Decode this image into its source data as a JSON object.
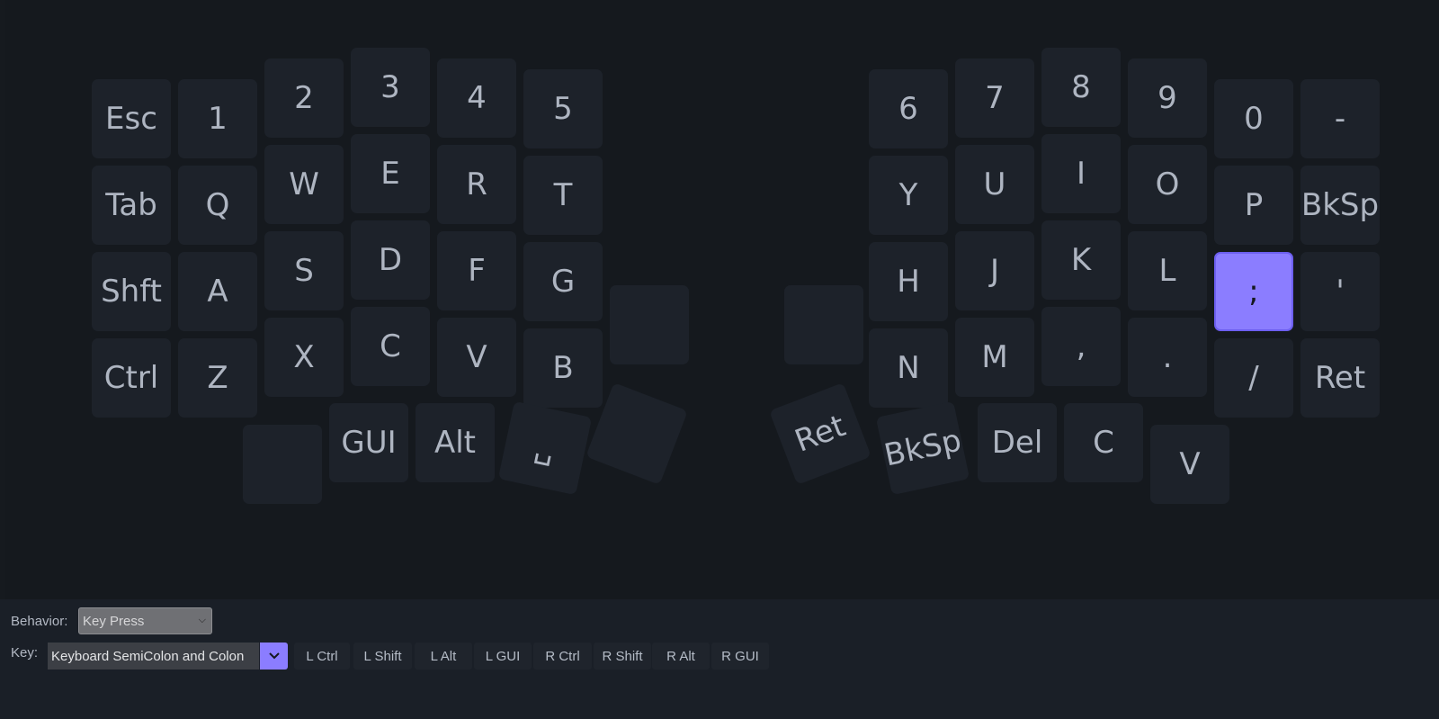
{
  "left_keys": [
    {
      "label": "Esc"
    },
    {
      "label": "1"
    },
    {
      "label": "2"
    },
    {
      "label": "3"
    },
    {
      "label": "4"
    },
    {
      "label": "5"
    },
    {
      "label": "Tab"
    },
    {
      "label": "Q"
    },
    {
      "label": "W"
    },
    {
      "label": "E"
    },
    {
      "label": "R"
    },
    {
      "label": "T"
    },
    {
      "label": "Shft"
    },
    {
      "label": "A"
    },
    {
      "label": "S"
    },
    {
      "label": "D"
    },
    {
      "label": "F"
    },
    {
      "label": "G"
    },
    {
      "label": ""
    },
    {
      "label": "Ctrl"
    },
    {
      "label": "Z"
    },
    {
      "label": "X"
    },
    {
      "label": "C"
    },
    {
      "label": "V"
    },
    {
      "label": "B"
    },
    {
      "label": ""
    },
    {
      "label": "GUI"
    },
    {
      "label": "Alt"
    },
    {
      "label": "␣"
    },
    {
      "label": ""
    }
  ],
  "right_keys": [
    {
      "label": "6"
    },
    {
      "label": "7"
    },
    {
      "label": "8"
    },
    {
      "label": "9"
    },
    {
      "label": "0"
    },
    {
      "label": "-"
    },
    {
      "label": "Y"
    },
    {
      "label": "U"
    },
    {
      "label": "I"
    },
    {
      "label": "O"
    },
    {
      "label": "P"
    },
    {
      "label": "BkSp"
    },
    {
      "label": ""
    },
    {
      "label": "H"
    },
    {
      "label": "J"
    },
    {
      "label": "K"
    },
    {
      "label": "L"
    },
    {
      "label": ";",
      "selected": true
    },
    {
      "label": "'"
    },
    {
      "label": "N"
    },
    {
      "label": "M"
    },
    {
      "label": ","
    },
    {
      "label": "."
    },
    {
      "label": "/"
    },
    {
      "label": "Ret"
    },
    {
      "label": "Ret"
    },
    {
      "label": "BkSp"
    },
    {
      "label": "Del"
    },
    {
      "label": "C"
    },
    {
      "label": "V"
    }
  ],
  "editor": {
    "behavior_label": "Behavior:",
    "behavior_value": "Key Press",
    "key_label": "Key:",
    "key_value": "Keyboard SemiColon and Colon",
    "modifiers": [
      "L Ctrl",
      "L Shift",
      "L Alt",
      "L GUI",
      "R Ctrl",
      "R Shift",
      "R Alt",
      "R GUI"
    ]
  },
  "colors": {
    "accent": "#8b7dff",
    "key_bg": "#1d222a",
    "background": "#15191e"
  }
}
